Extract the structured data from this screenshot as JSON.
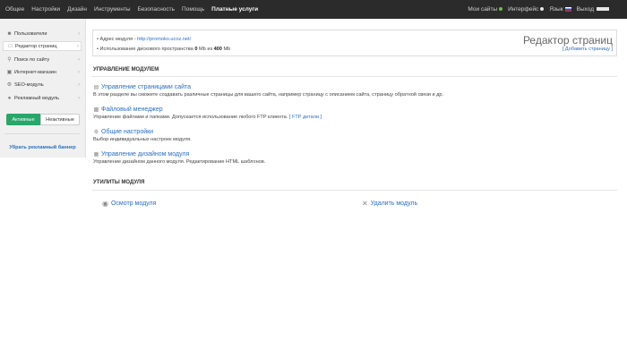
{
  "topbar": {
    "nav": [
      "Общее",
      "Настройки",
      "Дизайн",
      "Инструменты",
      "Безопасность",
      "Помощь"
    ],
    "paid": "Платные услуги",
    "my_sites": "Мои сайты",
    "interface": "Интерфейс",
    "language": "Язык",
    "exit": "Выход"
  },
  "sidebar": {
    "items": [
      {
        "label": "Пользователи",
        "icon": "user-icon"
      },
      {
        "label": "Редактор страниц",
        "icon": "page-icon"
      },
      {
        "label": "Поиск по сайту",
        "icon": "search-icon"
      },
      {
        "label": "Интернет-магазин",
        "icon": "cart-icon"
      },
      {
        "label": "SEO-модуль",
        "icon": "seo-icon"
      },
      {
        "label": "Рекламный модуль",
        "icon": "money-icon"
      }
    ],
    "toggle_active": "Активные",
    "toggle_inactive": "Неактивные",
    "remove_ad": "Убрать рекламный баннер"
  },
  "info": {
    "address_label": "Адрес модуля - ",
    "address_url": "http://promoko.ucoz.net/",
    "disk_label": "Использование дискового пространства ",
    "disk_used": "0",
    "disk_mid": " Mb из ",
    "disk_total": "400",
    "disk_unit": " Mb",
    "title": "Редактор страниц",
    "add_page": "[ Добавить страницу ]"
  },
  "manage": {
    "heading": "УПРАВЛЕНИЕ МОДУЛЕМ",
    "blocks": [
      {
        "title": "Управление страницами сайта",
        "desc": "В этом разделе вы сможете создавать различные страницы для вашего сайта, например страницу с описанием сайта, страницу обратной связи и др.",
        "icon": "pages-icon"
      },
      {
        "title": "Файловый менеджер",
        "desc": "Управление файлами и папками. Допускается использование любого FTP клиента.",
        "link": "[ FTP детали ]",
        "icon": "folder-icon"
      },
      {
        "title": "Общие настройки",
        "desc": "Выбор индивидуальных настроек модуля.",
        "icon": "settings-icon"
      },
      {
        "title": "Управление дизайном модуля",
        "desc": "Управление дизайном данного модуля. Редактирование HTML шаблонов.",
        "icon": "design-icon"
      }
    ]
  },
  "utils": {
    "heading": "УТИЛИТЫ МОДУЛЯ",
    "view": "Осмотр модуля",
    "delete": "Удалить модуль"
  }
}
